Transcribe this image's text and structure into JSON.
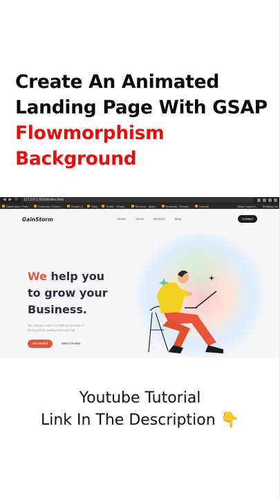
{
  "headline": {
    "line1": "Create An Animated",
    "line2": "Landing Page With GSAP",
    "line3": "Flowmorphism",
    "line4": "Background"
  },
  "browser": {
    "url": "127.0.0.1:5500/index.html",
    "bookmarks": [
      "Dashboard | Path...",
      "OnDecks | Python...",
      "Simple UI",
      "Sass",
      "Toolkit - Simple...",
      "Sho'wdo - Spaci...",
      "Business - Premiu...",
      "Youtube"
    ],
    "bookmarks_right": [
      "Wave Loader L...",
      "Reading List"
    ]
  },
  "site": {
    "logo": "GainStorm",
    "nav": [
      "Home",
      "About",
      "Services",
      "Blog"
    ],
    "contact": "Contact",
    "hero_accent": "We",
    "hero_line1_rest": " help you",
    "hero_line2": "to grow your",
    "hero_line3": "Business.",
    "description_line1": "Our ultimate motto is to fulfill the demand of",
    "description_line2": "the buyers by seeking them out of all.",
    "cta": "Get Started",
    "watch": "Watch Review"
  },
  "footer": {
    "line1": "Youtube Tutorial",
    "line2": "Link In The Description",
    "emoji": "👇"
  },
  "colors": {
    "headline_black": "#0b0b0b",
    "headline_red": "#e1100f",
    "brand_accent": "#e8553f"
  }
}
